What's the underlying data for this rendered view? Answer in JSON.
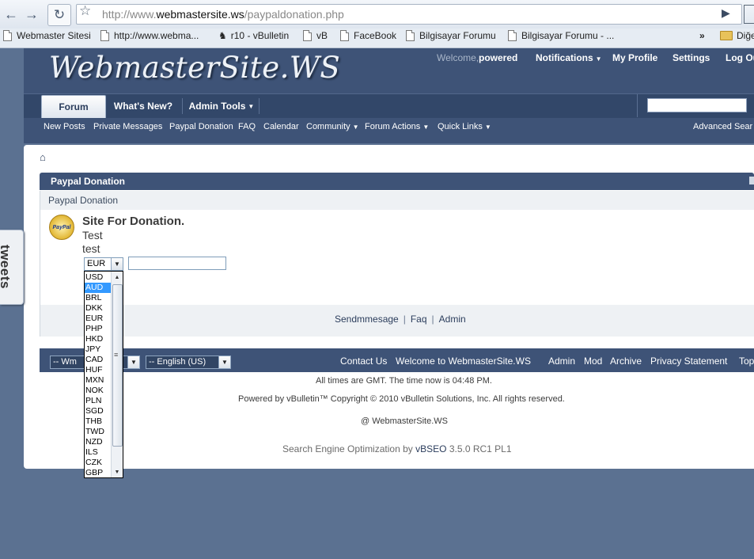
{
  "browser": {
    "url_prefix": "http://www.",
    "url_domain": "webmastersite.ws",
    "url_path": "/paypaldonation.php",
    "bookmarks": [
      "Webmaster Sitesi",
      "http://www.webma...",
      "r10 - vBulletin",
      "vB",
      "FaceBook",
      "Bilgisayar Forumu",
      "Bilgisayar Forumu - ..."
    ],
    "bookmarks_overflow": "»",
    "other_bookmarks": "Diğe"
  },
  "header": {
    "logo": "WebmasterSite.WS",
    "welcome": "Welcome,",
    "username": "powered",
    "notifications": "Notifications",
    "my_profile": "My Profile",
    "settings": "Settings",
    "logout": "Log Ou"
  },
  "navbar": {
    "tabs": [
      "Forum",
      "What's New?",
      "Admin Tools"
    ],
    "subnav": [
      "New Posts",
      "Private Messages",
      "Paypal Donation",
      "FAQ",
      "Calendar",
      "Community",
      "Forum Actions",
      "Quick Links"
    ],
    "advanced_search": "Advanced Sear"
  },
  "block": {
    "title": "Paypal Donation",
    "subtitle": "Paypal Donation",
    "seal_text": "PayPal",
    "donation_title": "Site For Donation.",
    "line1": "Test",
    "line2": "test",
    "currency_selected": "EUR",
    "currency_options": [
      "USD",
      "AUD",
      "BRL",
      "DKK",
      "EUR",
      "PHP",
      "HKD",
      "JPY",
      "CAD",
      "HUF",
      "MXN",
      "NOK",
      "PLN",
      "SGD",
      "THB",
      "TWD",
      "NZD",
      "ILS",
      "CZK",
      "GBP"
    ],
    "highlighted_option": "AUD",
    "footer_links": [
      "Sendmmesage",
      "Faq",
      "Admin"
    ]
  },
  "footer": {
    "style_select": "-- Wm",
    "language_select": "-- English (US)",
    "links": [
      "Contact Us",
      "Welcome to WebmasterSite.WS",
      "Admin",
      "Mod",
      "Archive",
      "Privacy Statement",
      "Top"
    ],
    "time_text": "All times are GMT. The time now is 04:48 PM.",
    "powered_text": "Powered by vBulletin™ Copyright © 2010 vBulletin Solutions, Inc. All rights reserved.",
    "site_credit": "@ WebmasterSite.WS",
    "seo_prefix": "Search Engine Optimization by",
    "seo_brand": "vBSEO",
    "seo_version": "3.5.0 RC1 PL1"
  },
  "tweets_tab": "tweets"
}
